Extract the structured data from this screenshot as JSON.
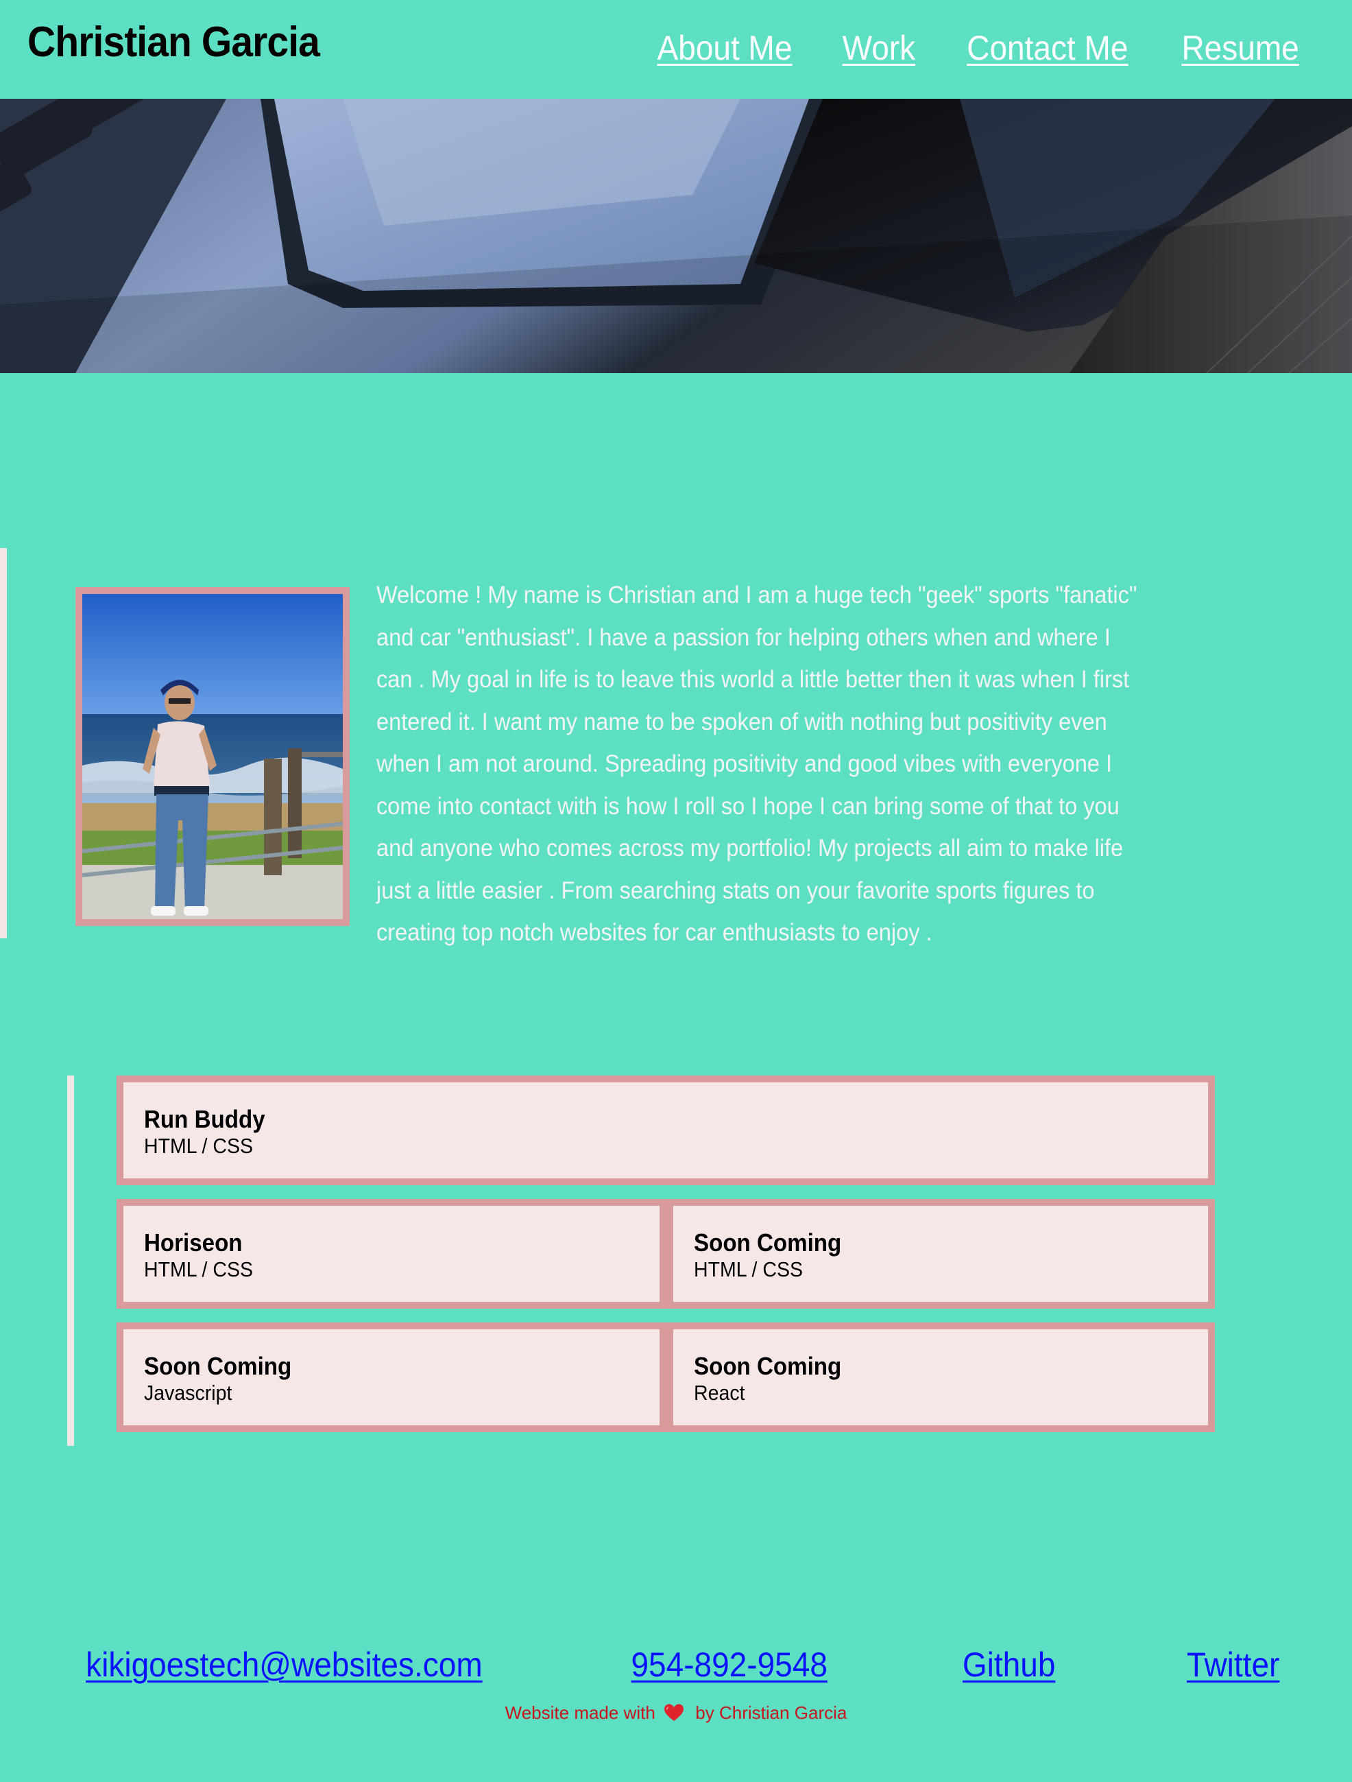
{
  "header": {
    "title": "Christian Garcia",
    "nav": [
      {
        "label": "About Me"
      },
      {
        "label": "Work"
      },
      {
        "label": "Contact Me"
      },
      {
        "label": "Resume"
      }
    ]
  },
  "hero": {
    "image": "hero-photo-laptop-and-tablet"
  },
  "about": {
    "photo": "profile-photo-man-at-beach",
    "text": "Welcome ! My name is Christian and I am a huge tech \"geek\" sports \"fanatic\" and car \"enthusiast\". I have a passion for helping others when and where I can . My goal in life is to leave this world a little better then it was when I first entered it. I want my name to be spoken of with nothing but positivity even when I am not around. Spreading positivity and good vibes with everyone I come into contact with is how I roll so I hope I can bring some of that to you and anyone who comes across my portfolio! My projects all aim to make life just a little easier . From searching stats on your favorite sports figures to creating top notch websites for car enthusiasts to enjoy ."
  },
  "work": {
    "projects": [
      {
        "title": "Run Buddy",
        "tech": "HTML / CSS"
      },
      {
        "title": "Horiseon",
        "tech": "HTML / CSS"
      },
      {
        "title": "Soon Coming",
        "tech": "HTML / CSS"
      },
      {
        "title": "Soon Coming",
        "tech": "Javascript"
      },
      {
        "title": "Soon Coming",
        "tech": "React"
      }
    ]
  },
  "footer": {
    "email": "kikigoestech@websites.com",
    "phone": "954-892-9548",
    "github": "Github",
    "twitter": "Twitter",
    "credit_prefix": "Website made with",
    "credit_suffix": "by Christian Garcia"
  },
  "colors": {
    "background": "#5ddfc3",
    "card_background": "#f6e7e6",
    "card_border": "#d99a9c",
    "link_blue": "#0a12ff",
    "credit_red": "#c9141c"
  },
  "icons": {
    "heart": "heart-icon"
  }
}
